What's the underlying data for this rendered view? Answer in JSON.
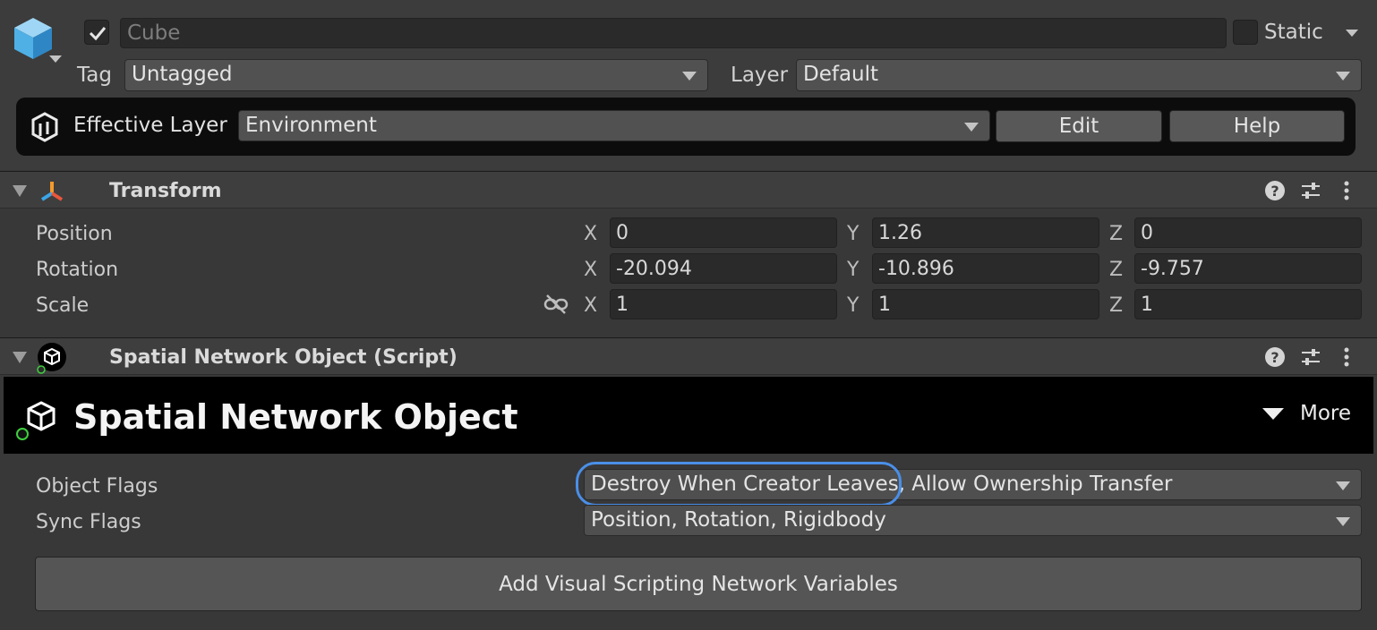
{
  "header": {
    "object_name": "Cube",
    "static_label": "Static",
    "tag_label": "Tag",
    "tag_value": "Untagged",
    "layer_label": "Layer",
    "layer_value": "Default",
    "effective_layer_label": "Effective Layer",
    "effective_layer_value": "Environment",
    "edit_button": "Edit",
    "help_button": "Help"
  },
  "transform": {
    "title": "Transform",
    "rows": [
      {
        "label": "Position",
        "x": "0",
        "y": "1.26",
        "z": "0"
      },
      {
        "label": "Rotation",
        "x": "-20.094",
        "y": "-10.896",
        "z": "-9.757"
      },
      {
        "label": "Scale",
        "x": "1",
        "y": "1",
        "z": "1"
      }
    ],
    "axes": {
      "x": "X",
      "y": "Y",
      "z": "Z"
    }
  },
  "spatial": {
    "component_title": "Spatial Network Object (Script)",
    "banner_title": "Spatial Network Object",
    "more_label": "More",
    "object_flags_label": "Object Flags",
    "object_flags_value": "Destroy When Creator Leaves, Allow Ownership Transfer",
    "sync_flags_label": "Sync Flags",
    "sync_flags_value": "Position, Rotation, Rigidbody",
    "add_button": "Add Visual Scripting Network Variables"
  },
  "colors": {
    "background": "#383838",
    "highlight": "#4a8fe8",
    "banner": "#000000"
  }
}
